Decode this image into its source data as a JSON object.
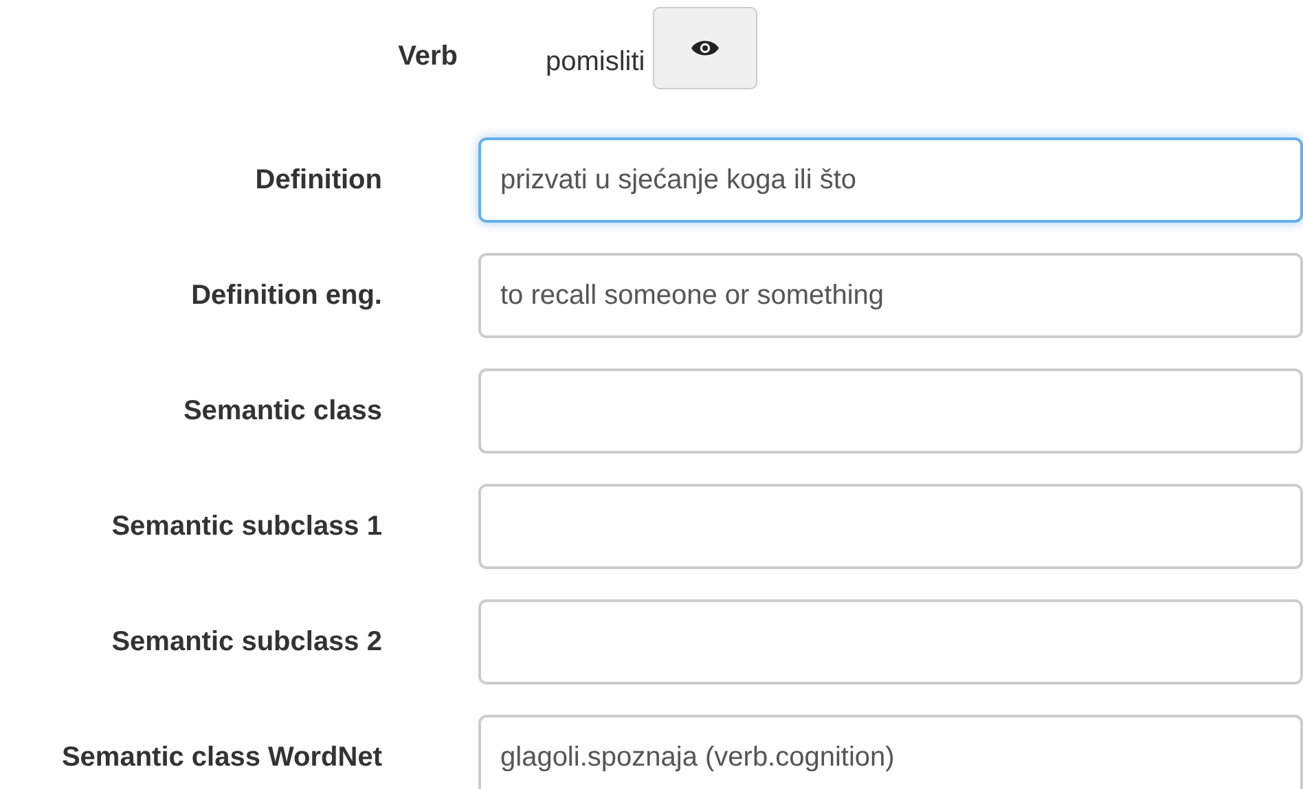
{
  "verb": {
    "label": "Verb",
    "value": "pomisliti"
  },
  "fields": [
    {
      "label": "Definition",
      "value": "prizvati u sjećanje koga ili što",
      "focused": true
    },
    {
      "label": "Definition eng.",
      "value": "to recall someone or something",
      "focused": false
    },
    {
      "label": "Semantic class",
      "focused": false
    },
    {
      "label": "Semantic subclass 1",
      "focused": false
    },
    {
      "label": "Semantic subclass 2",
      "focused": false
    },
    {
      "label": "Semantic class WordNet",
      "value": "glagoli.spoznaja (verb.cognition)",
      "focused": false
    }
  ]
}
